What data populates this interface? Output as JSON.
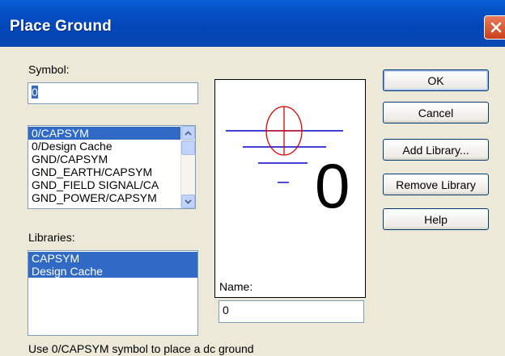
{
  "window": {
    "title": "Place Ground"
  },
  "symbol": {
    "label": "Symbol:",
    "value": "0",
    "list": [
      "0/CAPSYM",
      "0/Design Cache",
      "GND/CAPSYM",
      "GND_EARTH/CAPSYM",
      "GND_FIELD SIGNAL/CA",
      "GND_POWER/CAPSYM"
    ],
    "selected": "0/CAPSYM"
  },
  "libraries": {
    "label": "Libraries:",
    "items": [
      "CAPSYM",
      "Design Cache"
    ]
  },
  "preview": {
    "name_glyph": "0"
  },
  "name": {
    "label": "Name:",
    "value": "0"
  },
  "buttons": {
    "ok": "OK",
    "cancel": "Cancel",
    "add_library": "Add Library...",
    "remove_library": "Remove Library",
    "help": "Help"
  },
  "status": "Use 0/CAPSYM symbol to place a dc ground",
  "colors": {
    "title_bar": "#0146b8",
    "selection": "#316ac5",
    "symbol_red": "#e00000",
    "symbol_blue": "#0000c8"
  },
  "icons": {
    "close": "close-icon",
    "scroll_up": "chevron-up-icon",
    "scroll_down": "chevron-down-icon"
  }
}
